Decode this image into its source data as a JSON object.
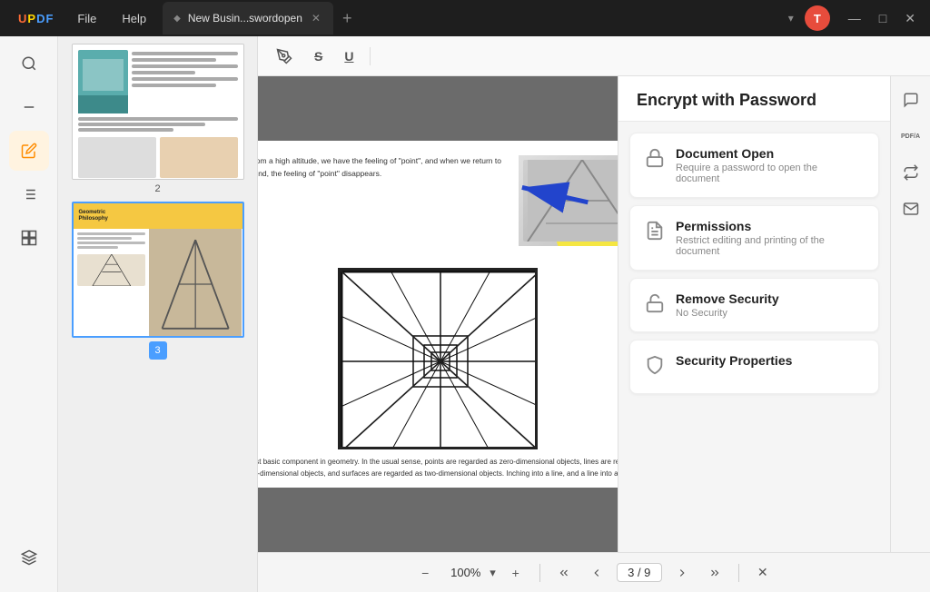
{
  "app": {
    "logo": "UPDF",
    "logo_letters": [
      "U",
      "P",
      "D",
      "F"
    ]
  },
  "title_bar": {
    "menu_items": [
      "File",
      "Help"
    ],
    "tab_title": "New Busin...swordopen",
    "tab_icon": "◆",
    "new_tab_icon": "+",
    "dropdown_icon": "▾",
    "avatar_letter": "T",
    "window_controls": [
      "—",
      "□",
      "✕"
    ]
  },
  "left_sidebar": {
    "icons": [
      {
        "name": "search",
        "symbol": "🔍",
        "active": false
      },
      {
        "name": "minus",
        "symbol": "—",
        "active": false
      },
      {
        "name": "edit",
        "symbol": "✏️",
        "active": true
      },
      {
        "name": "list",
        "symbol": "☰",
        "active": false
      },
      {
        "name": "pages",
        "symbol": "⊞",
        "active": false
      }
    ],
    "bottom_icons": [
      {
        "name": "layers",
        "symbol": "❑"
      }
    ]
  },
  "toolbar": {
    "icons": [
      {
        "name": "text-highlight",
        "symbol": "A̲"
      },
      {
        "name": "strikethrough",
        "symbol": "S̶"
      },
      {
        "name": "underline",
        "symbol": "U̲"
      }
    ]
  },
  "thumbnails": [
    {
      "page_num": "2",
      "selected": false
    },
    {
      "page_num": "3",
      "selected": true
    }
  ],
  "pdf_content": {
    "page_text_1": "street from a high altitude, we have the feeling of \"point\", and when we return to the ground, the feeling of \"point\" disappears.",
    "page_text_2": "the most basic component in geometry. In the usual sense, points are regarded as zero-dimensional objects, lines are regarded as one-dimensional objects, and surfaces are regarded as two-dimensional objects. Inching into a line, and a line into a plane."
  },
  "right_panel": {
    "header": "Encrypt with Password",
    "options": [
      {
        "id": "document-open",
        "icon": "🔒",
        "title": "Document Open",
        "subtitle": "Require a password to open the document"
      },
      {
        "id": "permissions",
        "icon": "📋",
        "title": "Permissions",
        "subtitle": "Restrict editing and printing of the document"
      },
      {
        "id": "remove-security",
        "icon": "🔓",
        "title": "Remove Security",
        "subtitle": "No Security"
      },
      {
        "id": "security-properties",
        "icon": "🛡",
        "title": "Security Properties",
        "subtitle": ""
      }
    ]
  },
  "right_toolbar_icons": [
    {
      "name": "comment",
      "symbol": "💬"
    },
    {
      "name": "pdf-a",
      "symbol": "PDF/A"
    },
    {
      "name": "convert",
      "symbol": "⇄"
    },
    {
      "name": "mail",
      "symbol": "✉"
    }
  ],
  "bottom_bar": {
    "zoom_out": "−",
    "zoom_value": "100%",
    "zoom_dropdown": "▾",
    "zoom_in": "+",
    "divider": "|",
    "first_page": "⇤",
    "prev_page": "‹",
    "page_display": "3 / 9",
    "next_page": "›",
    "last_page": "⇥",
    "close": "✕"
  }
}
